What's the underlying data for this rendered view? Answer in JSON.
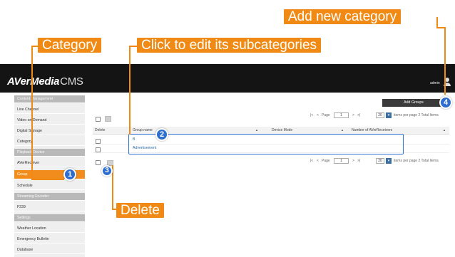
{
  "app": {
    "logo_main": "AVerMedia",
    "logo_suffix": "CMS",
    "user": "admin"
  },
  "sidebar": {
    "items": [
      {
        "label": "Content Management",
        "type": "section"
      },
      {
        "label": "Live Channel",
        "type": "item"
      },
      {
        "label": "Video on Demand",
        "type": "item"
      },
      {
        "label": "Digital Signage",
        "type": "item"
      },
      {
        "label": "Category",
        "type": "item"
      },
      {
        "label": "Playback Device",
        "type": "section"
      },
      {
        "label": "AVerReceiver",
        "type": "item"
      },
      {
        "label": "Group",
        "type": "active"
      },
      {
        "label": "Schedule",
        "type": "item"
      },
      {
        "label": "Streaming Encoder",
        "type": "section"
      },
      {
        "label": "F239",
        "type": "item"
      },
      {
        "label": "Settings",
        "type": "section"
      },
      {
        "label": "Weather Location",
        "type": "item"
      },
      {
        "label": "Emergency Bulletin",
        "type": "item"
      },
      {
        "label": "Database",
        "type": "item"
      }
    ]
  },
  "toolbar": {
    "add_groups_label": "Add Groups"
  },
  "pagination": {
    "nav_first": "|<",
    "nav_prev": "<",
    "page_label": "Page",
    "page_value": "1",
    "nav_next": ">",
    "nav_last": ">|",
    "per_page_value": "20",
    "per_page_text": "items per page 2 Total Items"
  },
  "table": {
    "headers": {
      "delete": "Delete",
      "group_name": "Group name",
      "device_mode": "Device Mode",
      "receivers": "Number of AVerReceivers"
    },
    "rows": [
      {
        "name": "B"
      },
      {
        "name": "Advertisement"
      }
    ]
  },
  "annotations": {
    "add_new_category": "Add new category",
    "category": "Category",
    "click_to_edit": "Click to edit its subcategories",
    "delete": "Delete",
    "badges": [
      "1",
      "2",
      "3",
      "4"
    ],
    "colors": {
      "callout": "#f08a14",
      "badge": "#2d6ecf",
      "highlight": "#2f73d4"
    }
  }
}
